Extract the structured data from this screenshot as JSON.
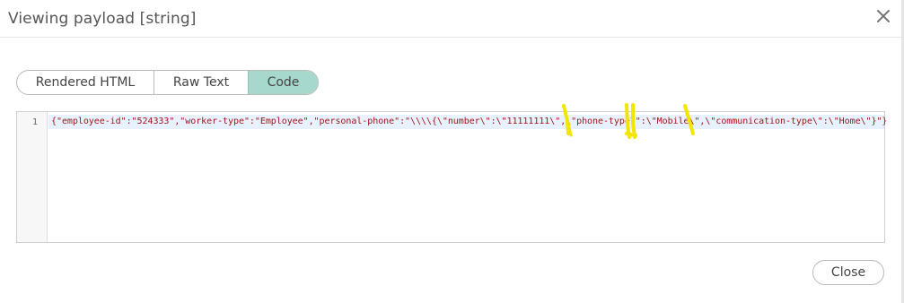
{
  "dialog": {
    "title": "Viewing payload [string]",
    "close_icon": "close-x-icon"
  },
  "tabs": [
    {
      "label": "Rendered HTML",
      "active": false
    },
    {
      "label": "Raw Text",
      "active": false
    },
    {
      "label": "Code",
      "active": true
    }
  ],
  "editor": {
    "line_number": "1",
    "code": "{\"employee-id\":\"524333\",\"worker-type\":\"Employee\",\"personal-phone\":\"\\\\\\\\{\\\"number\\\":\\\"11111111\\\",\\\"phone-type\\\":\\\"Mobile\\\",\\\"communication-type\\\":\\\"Home\\\"}\"}"
  },
  "footer": {
    "close_label": "Close"
  },
  "colors": {
    "active_tab": "#a6d8ce",
    "code_text": "#a31515",
    "line_highlight": "#e8f2ff",
    "highlighter_marks": "#f2e600"
  }
}
